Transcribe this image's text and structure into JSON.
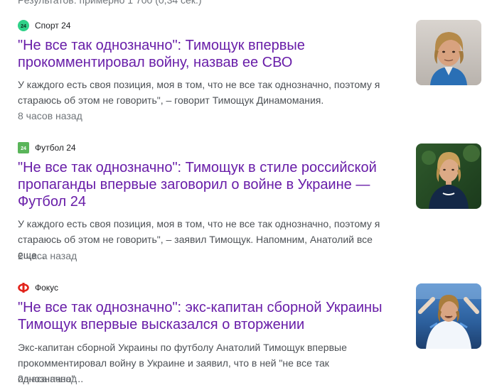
{
  "results_stats": "Результатов: примерно 1 700 (0,34 сек.)",
  "articles": [
    {
      "source": "Спорт 24",
      "favicon": "sport24-icon",
      "favicon_color": "#2fd188",
      "title": "\"Не все так однозначно\": Тимощук впервые прокомментировал войну, назвав ее СВО",
      "snippet": "У каждого есть своя позиция, моя в том, что не все так однозначно, поэтому я стараюсь об этом не говорить\", – говорит Тимощук Динамомания.",
      "time": "8 часов назад",
      "thumbnail": "portrait-photo-icon"
    },
    {
      "source": "Футбол 24",
      "favicon": "football24-icon",
      "favicon_color": "#5ab55a",
      "title": "\"Не все так однозначно\": Тимощук в стиле российской пропаганды впервые заговорил о войне в Украине — Футбол 24",
      "snippet": "У каждого есть своя позиция, моя в том, что не все так однозначно, поэтому я стараюсь об этом не говорить\", – заявил Тимощук. Напомним, Анатолий все еще...",
      "time": "2 часа назад",
      "thumbnail": "coach-photo-icon"
    },
    {
      "source": "Фокус",
      "favicon": "fokus-icon",
      "favicon_color": "#e2231a",
      "title": "\"Не все так однозначно\": экс-капитан сборной Украины Тимощук впервые высказался о вторжении",
      "snippet": "Экс-капитан сборной Украины по футболу Анатолий Тимощук впервые прокомментировал войну в Украине и заявил, что в ней \"не все так однозначно\"...",
      "time": "2 часа назад",
      "thumbnail": "stadium-photo-icon"
    }
  ],
  "colors": {
    "title_visited": "#681da8",
    "snippet": "#4d5156",
    "meta": "#70757a"
  }
}
